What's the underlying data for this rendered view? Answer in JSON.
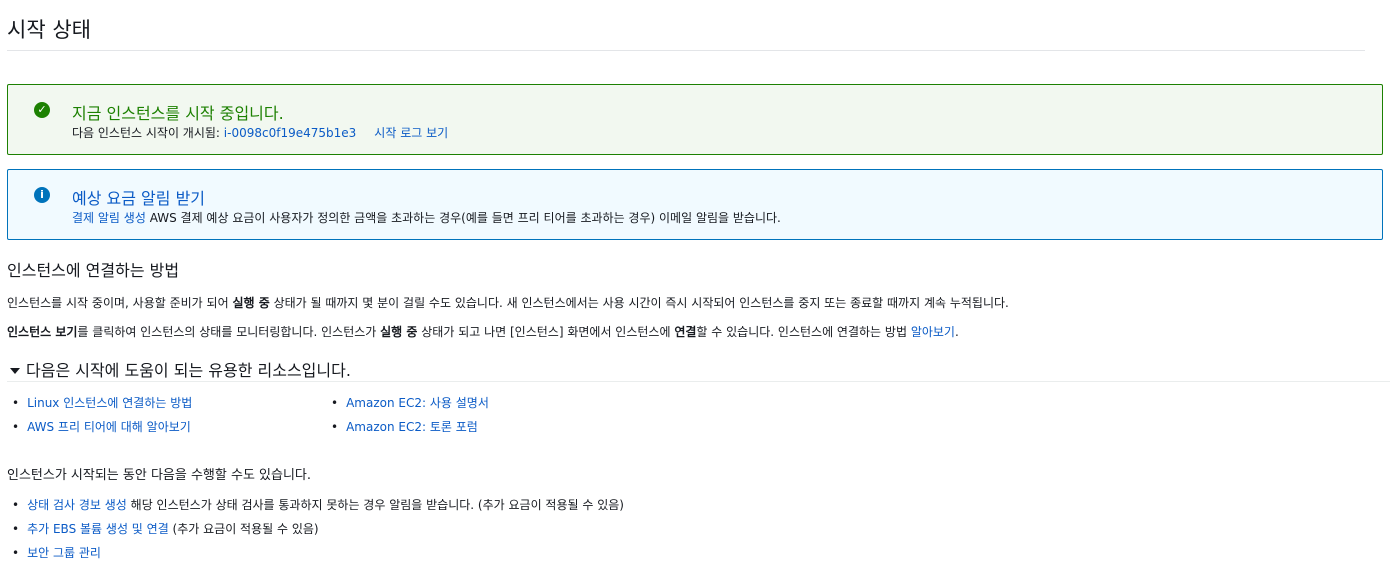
{
  "page": {
    "title": "시작 상태"
  },
  "success_alert": {
    "title": "지금 인스턴스를 시작 중입니다.",
    "body_prefix": "다음 인스턴스 시작이 개시됨: ",
    "instance_id": "i-0098c0f19e475b1e3",
    "log_link": "시작 로그 보기",
    "color": "#1d8102"
  },
  "info_alert": {
    "title": "예상 요금 알림 받기",
    "link": "결제 알림 생성",
    "body": " AWS 결제 예상 요금이 사용자가 정의한 금액을 초과하는 경우(예를 들면 프리 티어를 초과하는 경우) 이메일 알림을 받습니다.",
    "color": "#0073bb"
  },
  "connect": {
    "heading": "인스턴스에 연결하는 방법",
    "p1_a": "인스턴스를 시작 중이며, 사용할 준비가 되어 ",
    "p1_b": "실행 중",
    "p1_c": " 상태가 될 때까지 몇 분이 걸릴 수도 있습니다. 새 인스턴스에서는 사용 시간이 즉시 시작되어 인스턴스를 중지 또는 종료할 때까지 계속 누적됩니다.",
    "p2_a": "인스턴스 보기",
    "p2_b": "를 클릭하여 인스턴스의 상태를 모니터링합니다. 인스턴스가 ",
    "p2_c": "실행 중",
    "p2_d": " 상태가 되고 나면 [인스턴스] 화면에서 인스턴스에 ",
    "p2_e": "연결",
    "p2_f": "할 수 있습니다. 인스턴스에 연결하는 방법 ",
    "p2_link": "알아보기",
    "p2_end": "."
  },
  "resources": {
    "heading": "다음은 시작에 도움이 되는 유용한 리소스입니다.",
    "left": [
      "Linux 인스턴스에 연결하는 방법",
      "AWS 프리 티어에 대해 알아보기"
    ],
    "right": [
      "Amazon EC2: 사용 설명서",
      "Amazon EC2: 토론 포럼"
    ]
  },
  "tasks": {
    "intro": "인스턴스가 시작되는 동안 다음을 수행할 수도 있습니다.",
    "items": [
      {
        "link": "상태 검사 경보 생성",
        "text": " 해당 인스턴스가 상태 검사를 통과하지 못하는 경우 알림을 받습니다. (추가 요금이 적용될 수 있음)"
      },
      {
        "link": "추가 EBS 볼륨 생성 및 연결",
        "text": " (추가 요금이 적용될 수 있음)"
      },
      {
        "link": "보안 그룹 관리",
        "text": ""
      }
    ]
  },
  "link_color": "#0b5bc6"
}
